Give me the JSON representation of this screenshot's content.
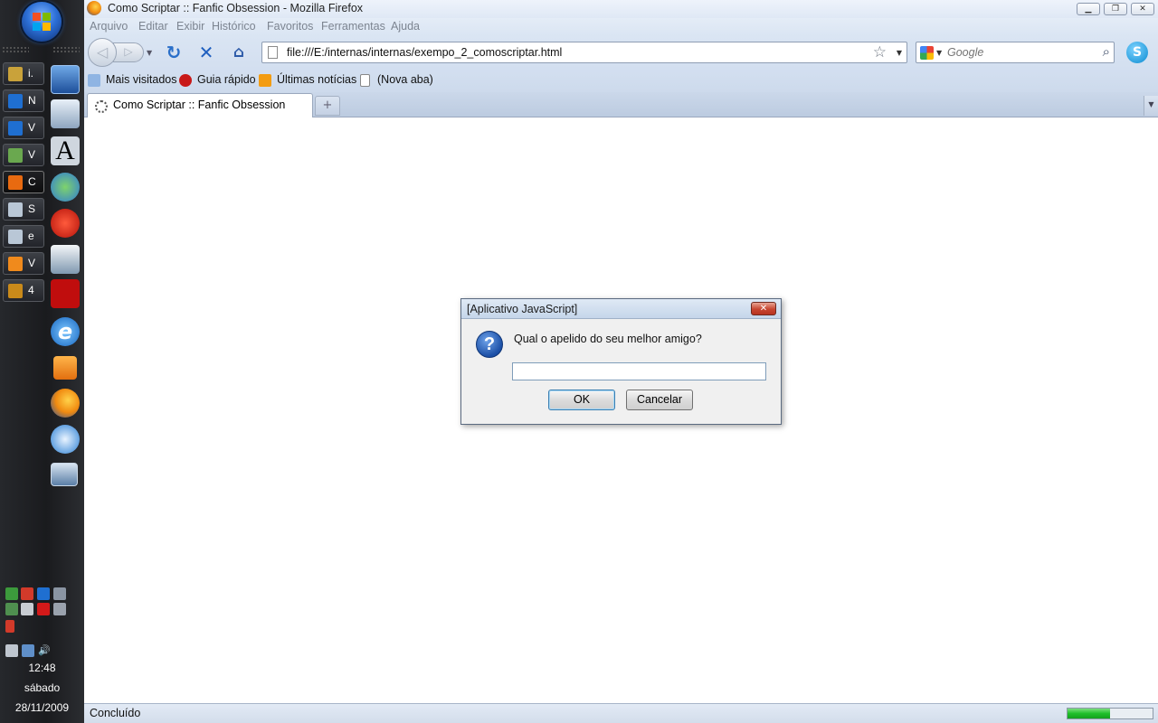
{
  "taskbar": {
    "task_buttons": [
      {
        "label": "i.",
        "icon": "install-icon",
        "color": "#c9a23a"
      },
      {
        "label": "N",
        "icon": "vivo-icon",
        "color": "#1f6fd1"
      },
      {
        "label": "V",
        "icon": "vivo-icon",
        "color": "#1f6fd1"
      },
      {
        "label": "V",
        "icon": "network-users-icon",
        "color": "#6aa84f"
      },
      {
        "label": "C",
        "icon": "firefox-icon",
        "color": "#e86a10",
        "active": true
      },
      {
        "label": "S",
        "icon": "notepad-icon",
        "color": "#b9c7d6"
      },
      {
        "label": "e",
        "icon": "notepad-icon",
        "color": "#b9c7d6"
      },
      {
        "label": "V",
        "icon": "media-player-icon",
        "color": "#f08a1c"
      },
      {
        "label": "4",
        "icon": "winamp-icon",
        "color": "#c98a1a"
      }
    ],
    "clock": {
      "time": "12:48",
      "day": "sábado",
      "date": "28/11/2009"
    }
  },
  "window": {
    "title": "Como Scriptar :: Fanfic Obsession - Mozilla Firefox",
    "menu": [
      "Arquivo",
      "Editar",
      "Exibir",
      "Histórico",
      "Favoritos",
      "Ferramentas",
      "Ajuda"
    ],
    "url": "file:///E:/internas/internas/exempo_2_comoscriptar.html",
    "search_placeholder": "Google",
    "bookmarks": [
      "Mais visitados",
      "Guia rápido",
      "Últimas notícias",
      "(Nova aba)"
    ],
    "tab_title": "Como Scriptar :: Fanfic Obsession",
    "status": "Concluído",
    "progress_fraction": 0.5
  },
  "dialog": {
    "title": "[Aplicativo JavaScript]",
    "message": "Qual o apelido do seu melhor amigo?",
    "input_value": "",
    "ok_label": "OK",
    "cancel_label": "Cancelar"
  }
}
